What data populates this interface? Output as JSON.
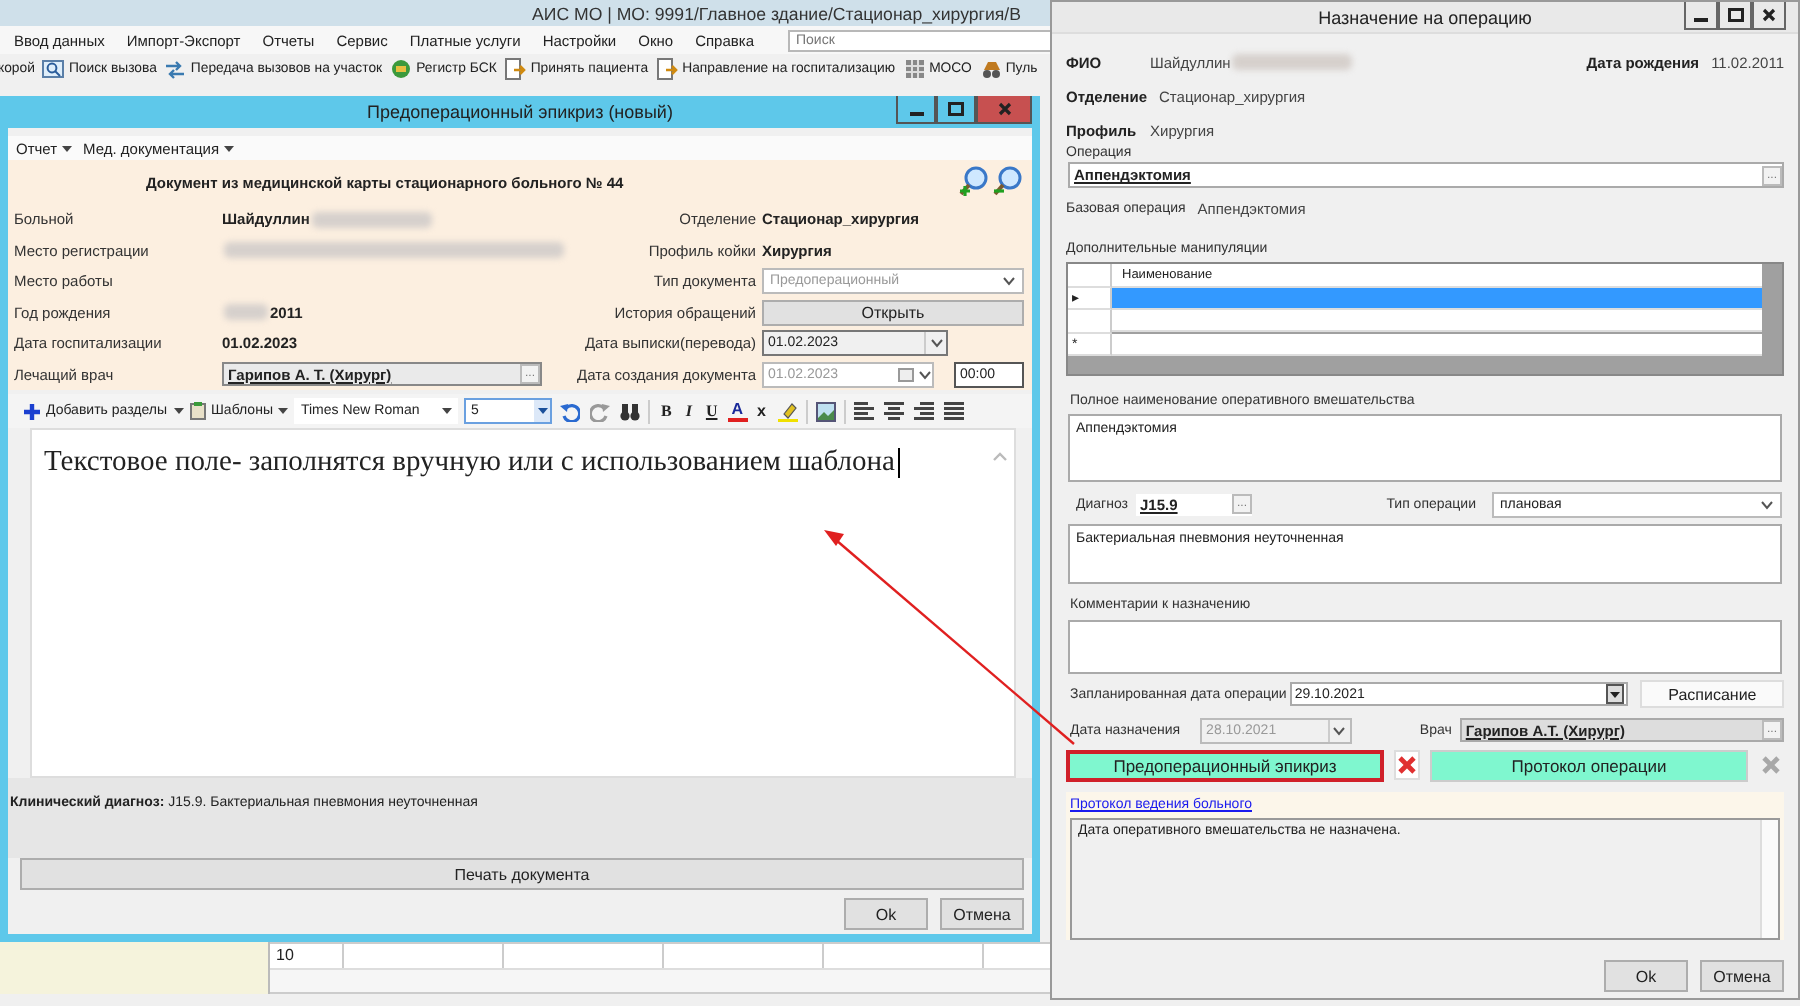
{
  "app": {
    "title": "АИС МО | МО: 9991/Главное здание/Стационар_хирургия/В",
    "menu": [
      "Ввод данных",
      "Импорт-Экспорт",
      "Отчеты",
      "Сервис",
      "Платные услуги",
      "Настройки",
      "Окно",
      "Справка"
    ],
    "search": {
      "placeholder": "Поиск"
    },
    "toolbar": [
      {
        "label": "корой",
        "kind": "fragment"
      },
      {
        "label": "Поиск вызова",
        "kind": "button"
      },
      {
        "label": "Передача вызовов на участок",
        "kind": "button"
      },
      {
        "label": "Регистр БСК",
        "kind": "button"
      },
      {
        "label": "Принять пациента",
        "kind": "button"
      },
      {
        "label": "Направление на госпитализацию",
        "kind": "button"
      },
      {
        "label": "МОСО",
        "kind": "button"
      },
      {
        "label": "Пуль",
        "kind": "button"
      }
    ],
    "table_row": "10"
  },
  "epicrisis": {
    "title": "Предоперационный эпикриз (новый)",
    "menus": [
      "Отчет",
      "Мед. документация"
    ],
    "heading": "Документ из медицинской карты стационарного больного №  44",
    "form_left": [
      {
        "label": "Больной",
        "kind": "name",
        "value": "Шайдуллин"
      },
      {
        "label": "Место регистрации",
        "kind": "blurred"
      },
      {
        "label": "Место работы",
        "kind": "empty"
      },
      {
        "label": "Год рождения",
        "kind": "year",
        "value": "2011"
      },
      {
        "label": "Дата госпитализации",
        "kind": "bold",
        "value": "01.02.2023"
      },
      {
        "label": "Лечащий врач",
        "kind": "picker",
        "value": "Гарипов А. Т. (Хирург)",
        "glyph": "..."
      }
    ],
    "form_right": [
      {
        "label": "Отделение",
        "kind": "bold",
        "value": "Стационар_хирургия"
      },
      {
        "label": "Профиль койки",
        "kind": "bold",
        "value": "Хирургия"
      },
      {
        "label": "Тип документа",
        "kind": "combo",
        "value": "Предоперационный",
        "disabled": true
      },
      {
        "label": "История обращений",
        "kind": "button",
        "value": "Открыть"
      },
      {
        "label": "Дата выписки(перевода)",
        "kind": "date",
        "value": "01.02.2023",
        "disabled": false
      },
      {
        "label": "Дата создания документа",
        "kind": "datetime",
        "value": "01.02.2023",
        "time": "00:00",
        "disabled": true
      }
    ],
    "toolbar": {
      "add_sections": "Добавить разделы",
      "templates": "Шаблоны",
      "font": "Times New Roman",
      "size": "5",
      "format_buttons": [
        {
          "glyph": "B",
          "kind": "bold"
        },
        {
          "glyph": "I",
          "kind": "italic"
        },
        {
          "glyph": "U",
          "kind": "underline"
        },
        {
          "glyph": "A",
          "kind": "font_color"
        },
        {
          "glyph": "x",
          "kind": "superscript"
        }
      ]
    },
    "editor_text": "Текстовое поле- заполнятся вручную или с использованием шаблона",
    "diagnosis": "**Клинический диагноз:** J15.9. Бактериальная пневмония неуточненная",
    "print_button": "Печать документа",
    "buttons": [
      "Ok",
      "Отмена"
    ]
  },
  "assignment": {
    "title": "Назначение на операцию",
    "fio": {
      "label": "ФИО",
      "value": "Шайдуллин"
    },
    "birth": {
      "label": "Дата рождения",
      "value": "11.02.2011"
    },
    "department": {
      "label": "Отделение",
      "value": "Стационар_хирургия"
    },
    "profile": {
      "label": "Профиль",
      "value": "Хирургия"
    },
    "operation": {
      "label": "Операция",
      "value": "Аппендэктомия",
      "glyph": "..."
    },
    "base_operation": {
      "label": "Базовая операция",
      "value": "Аппендэктомия"
    },
    "manipulations": {
      "label": "Дополнительные манипуляции",
      "column": "Наименование",
      "rows": [
        {
          "marker": "▸",
          "selected": true
        },
        {
          "selected": false
        },
        {
          "marker": "*",
          "selected": false
        }
      ]
    },
    "full_name": {
      "label": "Полное наименование оперативного вмешательства",
      "value": "Аппендэктомия"
    },
    "diagnosis": {
      "label": "Диагноз",
      "code": "J15.9",
      "glyph": "...",
      "text": "Бактериальная пневмония неуточненная"
    },
    "operation_type": {
      "label": "Тип операции",
      "value": "плановая"
    },
    "comments": {
      "label": "Комментарии к назначению"
    },
    "planned_date": {
      "label": "Запланированная дата операции",
      "value": "29.10.2021",
      "button": "Расписание"
    },
    "assigned_date": {
      "label": "Дата назначения",
      "value": "28.10.2021",
      "disabled": true
    },
    "doctor": {
      "label": "Врач",
      "value": "Гарипов А.Т. (Хирург)",
      "glyph": "...",
      "disabled": true
    },
    "documents": [
      {
        "label": "Предоперационный эпикриз",
        "highlighted": true,
        "delete_enabled": true
      },
      {
        "label": "Протокол операции",
        "highlighted": false,
        "delete_enabled": false
      }
    ],
    "log_link": "Протокол ведения больного",
    "log_text": "Дата оперативного вмешательства не назначена.",
    "buttons": [
      "Ok",
      "Отмена"
    ]
  }
}
